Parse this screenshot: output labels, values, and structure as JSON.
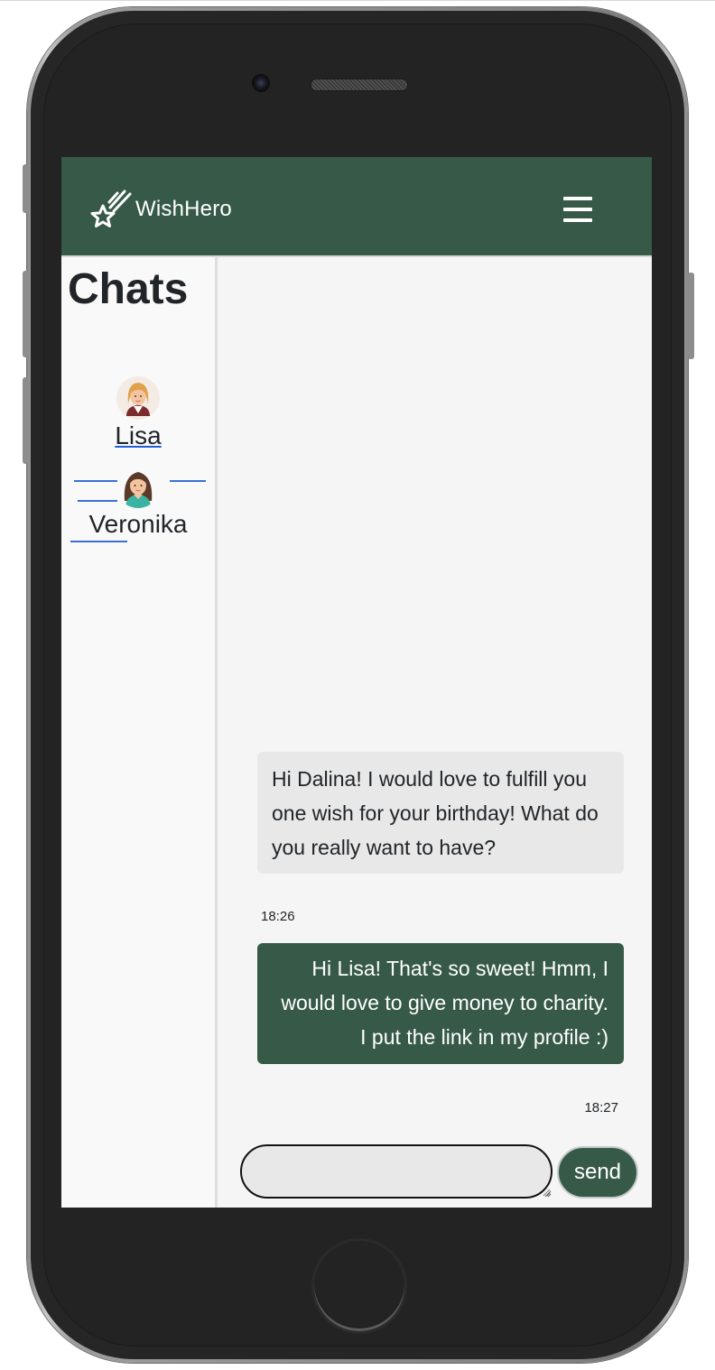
{
  "app": {
    "brand": "WishHero",
    "brand_icon": "shooting-star-icon",
    "menu_icon": "hamburger-menu-icon",
    "accent_color": "#375a48"
  },
  "sidebar": {
    "title": "Chats",
    "contacts": [
      {
        "name": "Lisa",
        "avatar": "avatar-lisa"
      },
      {
        "name": "Veronika",
        "avatar": "avatar-veronika"
      }
    ]
  },
  "chat": {
    "messages": [
      {
        "direction": "incoming",
        "text": "Hi Dalina! I would love to fulfill you one wish for your birthday! What do you really want to have?",
        "time": "18:26"
      },
      {
        "direction": "outgoing",
        "text": "Hi Lisa! That's so sweet! Hmm, I would love to give money to charity. I put the link in my profile :)",
        "time": "18:27"
      }
    ],
    "input": {
      "value": "",
      "placeholder": ""
    },
    "send_label": "send"
  }
}
